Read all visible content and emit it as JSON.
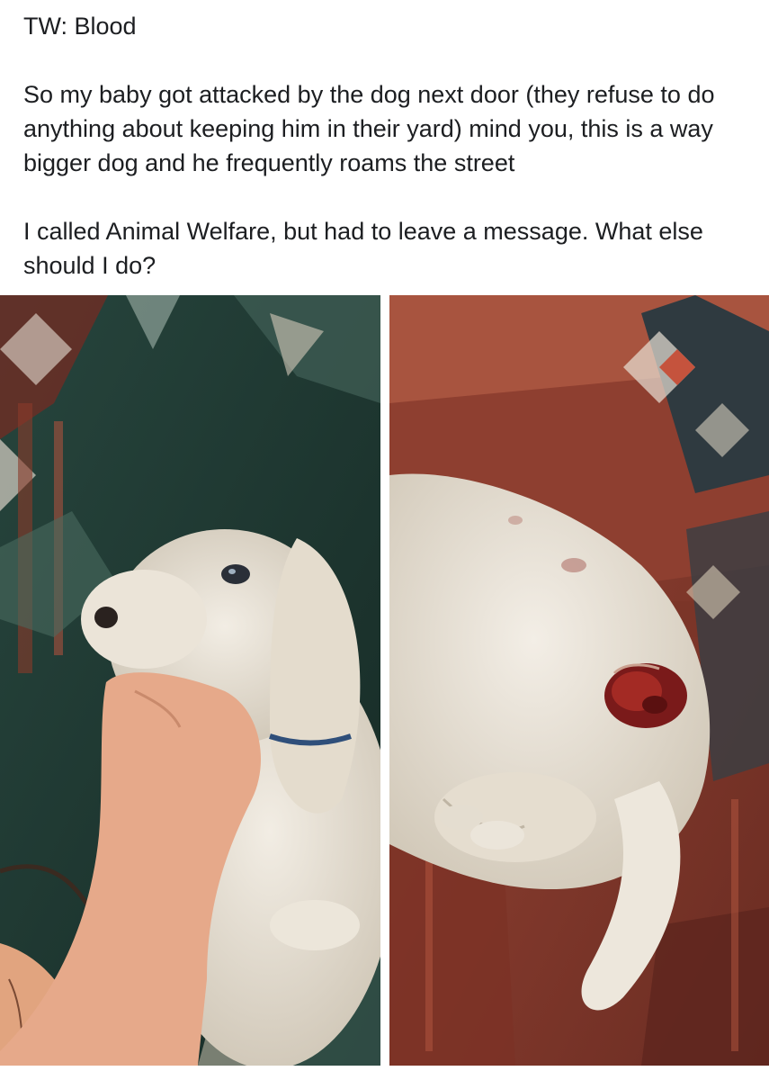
{
  "post": {
    "trigger_warning": "TW: Blood",
    "paragraph_1": "So my baby got attacked by the dog next door (they refuse to do anything about keeping him in their yard) mind you, this is a way bigger dog and he frequently roams the street",
    "paragraph_2": "I called Animal Welfare, but had to leave a message. What else should I do?"
  },
  "photos": [
    {
      "name": "dog-face-photo"
    },
    {
      "name": "dog-wound-photo"
    }
  ],
  "colors": {
    "background": "#ffffff",
    "text": "#1c1e21",
    "couch_green": "#1f3a33",
    "couch_red": "#8a3a2a",
    "fur": "#e8e1d6",
    "wound": "#7a1a1a",
    "skin": "#e6a98a"
  }
}
